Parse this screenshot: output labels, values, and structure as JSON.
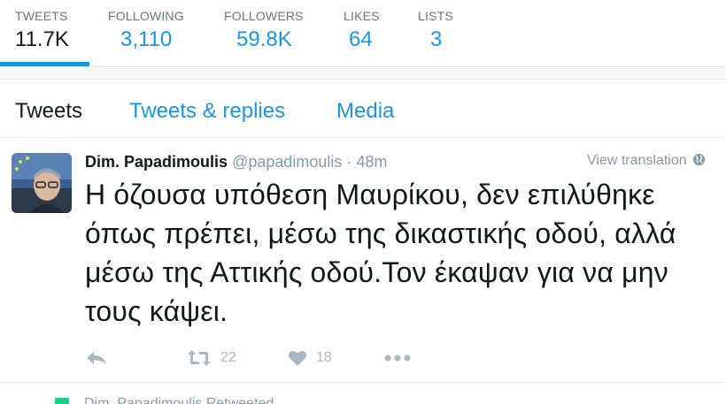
{
  "stats": [
    {
      "label": "TWEETS",
      "value": "11.7K"
    },
    {
      "label": "FOLLOWING",
      "value": "3,110"
    },
    {
      "label": "FOLLOWERS",
      "value": "59.8K"
    },
    {
      "label": "LIKES",
      "value": "64"
    },
    {
      "label": "LISTS",
      "value": "3"
    }
  ],
  "tabs": [
    {
      "label": "Tweets"
    },
    {
      "label": "Tweets & replies"
    },
    {
      "label": "Media"
    }
  ],
  "tweet": {
    "name": "Dim. Papadimoulis",
    "handle": "@papadimoulis",
    "separator": "·",
    "time": "48m",
    "translate": "View translation",
    "text": "Η όζουσα υπόθεση Μαυρίκου, δεν επιλύθηκε όπως πρέπει, μέσω της δικαστικής οδού, αλλά μέσω της Αττικής οδού.Τον έκαψαν για να μην τους κάψει.",
    "retweets": "22",
    "likes": "18"
  },
  "next": {
    "text": "Dim. Papadimoulis Retweeted"
  },
  "colors": {
    "accent": "#1b95e0",
    "muted": "#8899a6",
    "action": "#aab8c2",
    "retweet_green": "#19cf86"
  },
  "icons": [
    "reply-icon",
    "retweet-icon",
    "heart-icon",
    "more-icon",
    "globe-icon",
    "retweet-badge-icon"
  ]
}
